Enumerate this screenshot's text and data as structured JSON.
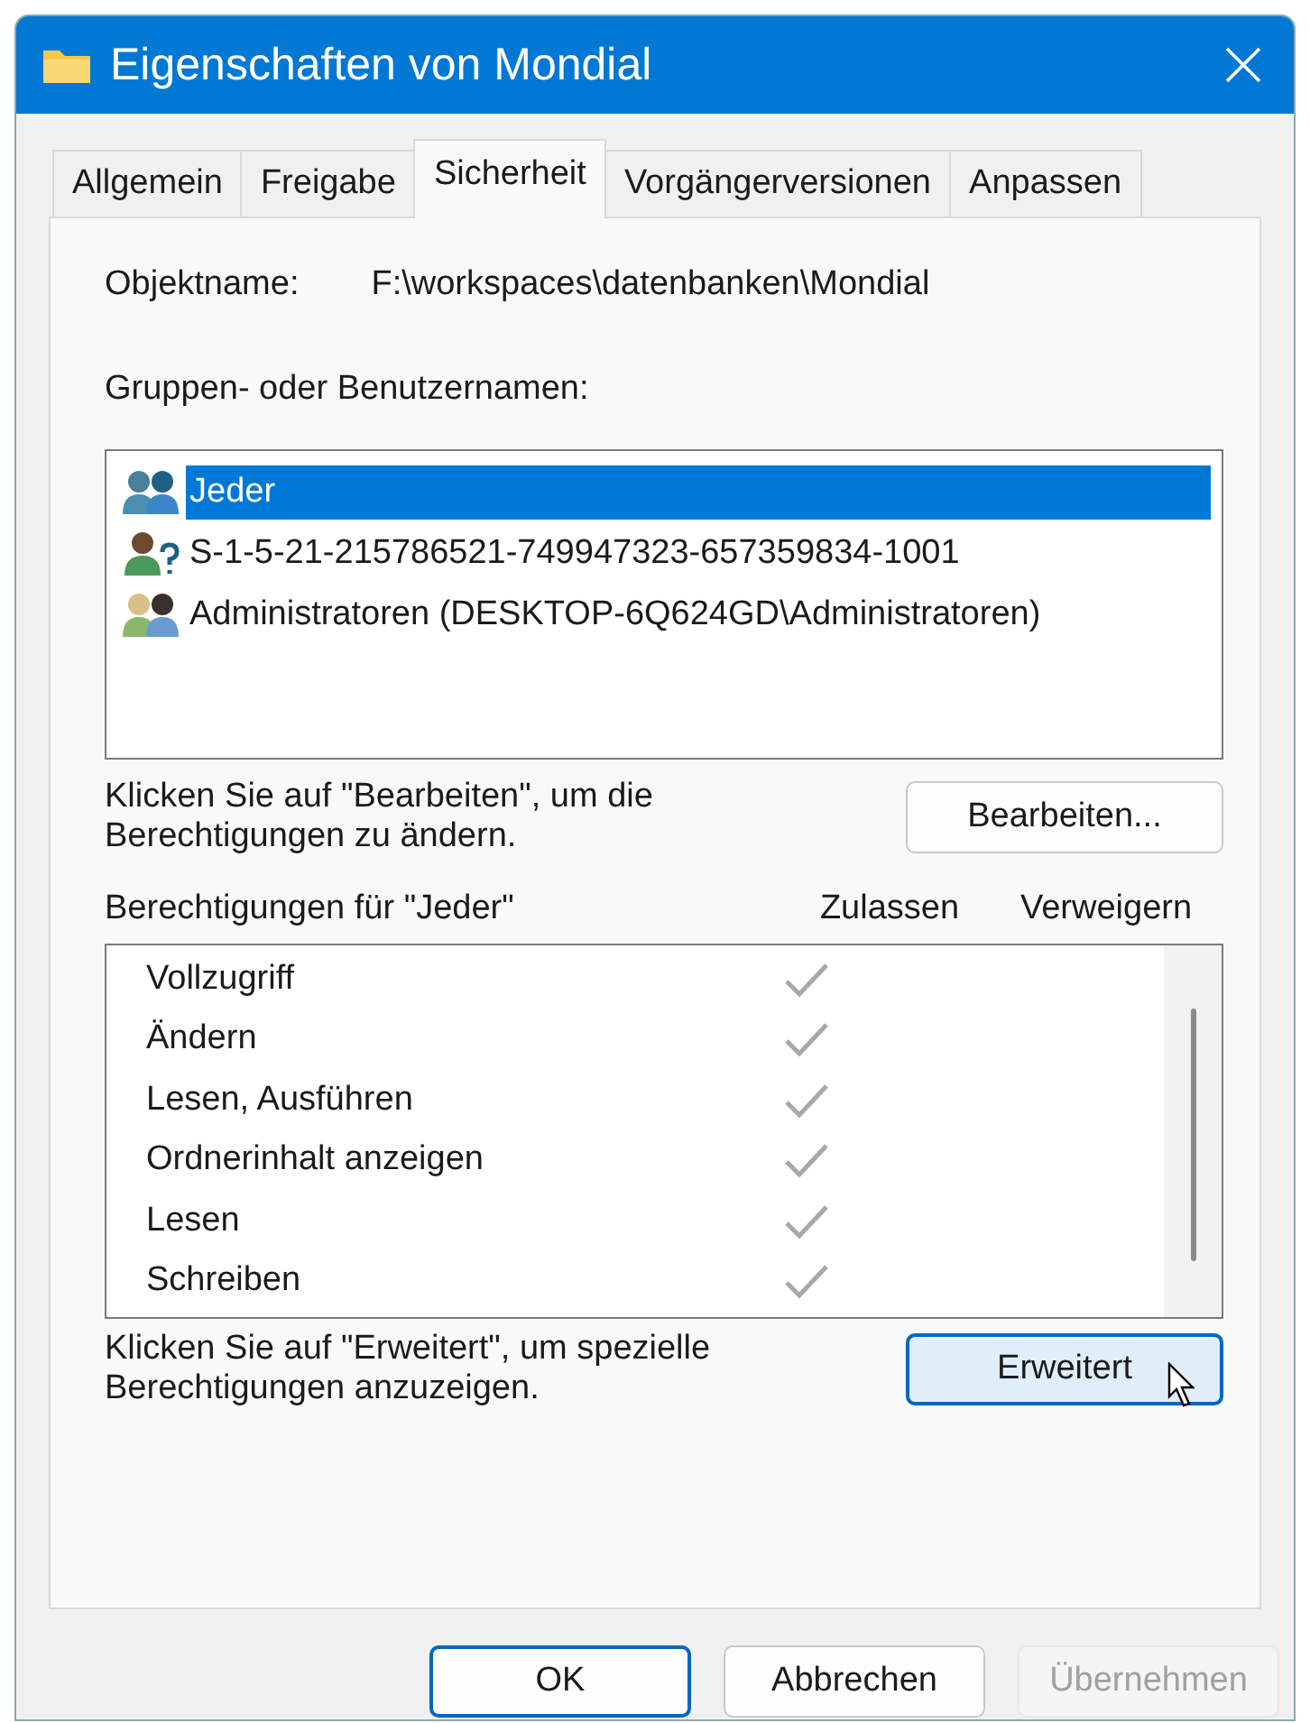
{
  "window": {
    "title": "Eigenschaften von Mondial"
  },
  "tabs": [
    {
      "label": "Allgemein",
      "selected": false
    },
    {
      "label": "Freigabe",
      "selected": false
    },
    {
      "label": "Sicherheit",
      "selected": true
    },
    {
      "label": "Vorgängerversionen",
      "selected": false
    },
    {
      "label": "Anpassen",
      "selected": false
    }
  ],
  "object_name": {
    "label": "Objektname:",
    "value": "F:\\workspaces\\datenbanken\\Mondial"
  },
  "groups": {
    "label": "Gruppen- oder Benutzernamen:",
    "items": [
      {
        "name": "Jeder",
        "kind": "group",
        "selected": true
      },
      {
        "name": "S-1-5-21-215786521-749947323-657359834-1001",
        "kind": "unknown",
        "selected": false
      },
      {
        "name": "Administratoren (DESKTOP-6Q624GD\\Administratoren)",
        "kind": "admins",
        "selected": false
      }
    ]
  },
  "edit_hint": "Klicken Sie auf \"Bearbeiten\", um die Berechtigungen zu ändern.",
  "edit_button": {
    "label": "Bearbeiten...",
    "hovered": false
  },
  "permissions": {
    "label": "Berechtigungen für \"Jeder\"",
    "allow_header": "Zulassen",
    "deny_header": "Verweigern",
    "rows": [
      {
        "name": "Vollzugriff",
        "allow": true,
        "deny": false
      },
      {
        "name": "Ändern",
        "allow": true,
        "deny": false
      },
      {
        "name": "Lesen, Ausführen",
        "allow": true,
        "deny": false
      },
      {
        "name": "Ordnerinhalt anzeigen",
        "allow": true,
        "deny": false
      },
      {
        "name": "Lesen",
        "allow": true,
        "deny": false
      },
      {
        "name": "Schreiben",
        "allow": true,
        "deny": false
      }
    ]
  },
  "advanced_hint": "Klicken Sie auf \"Erweitert\", um spezielle Berechtigungen anzuzeigen.",
  "advanced_button": {
    "label": "Erweitert",
    "hovered": true
  },
  "buttons": [
    {
      "label": "OK",
      "default": true,
      "disabled": false
    },
    {
      "label": "Abbrechen",
      "default": false,
      "disabled": false
    },
    {
      "label": "Übernehmen",
      "default": false,
      "disabled": true
    }
  ]
}
